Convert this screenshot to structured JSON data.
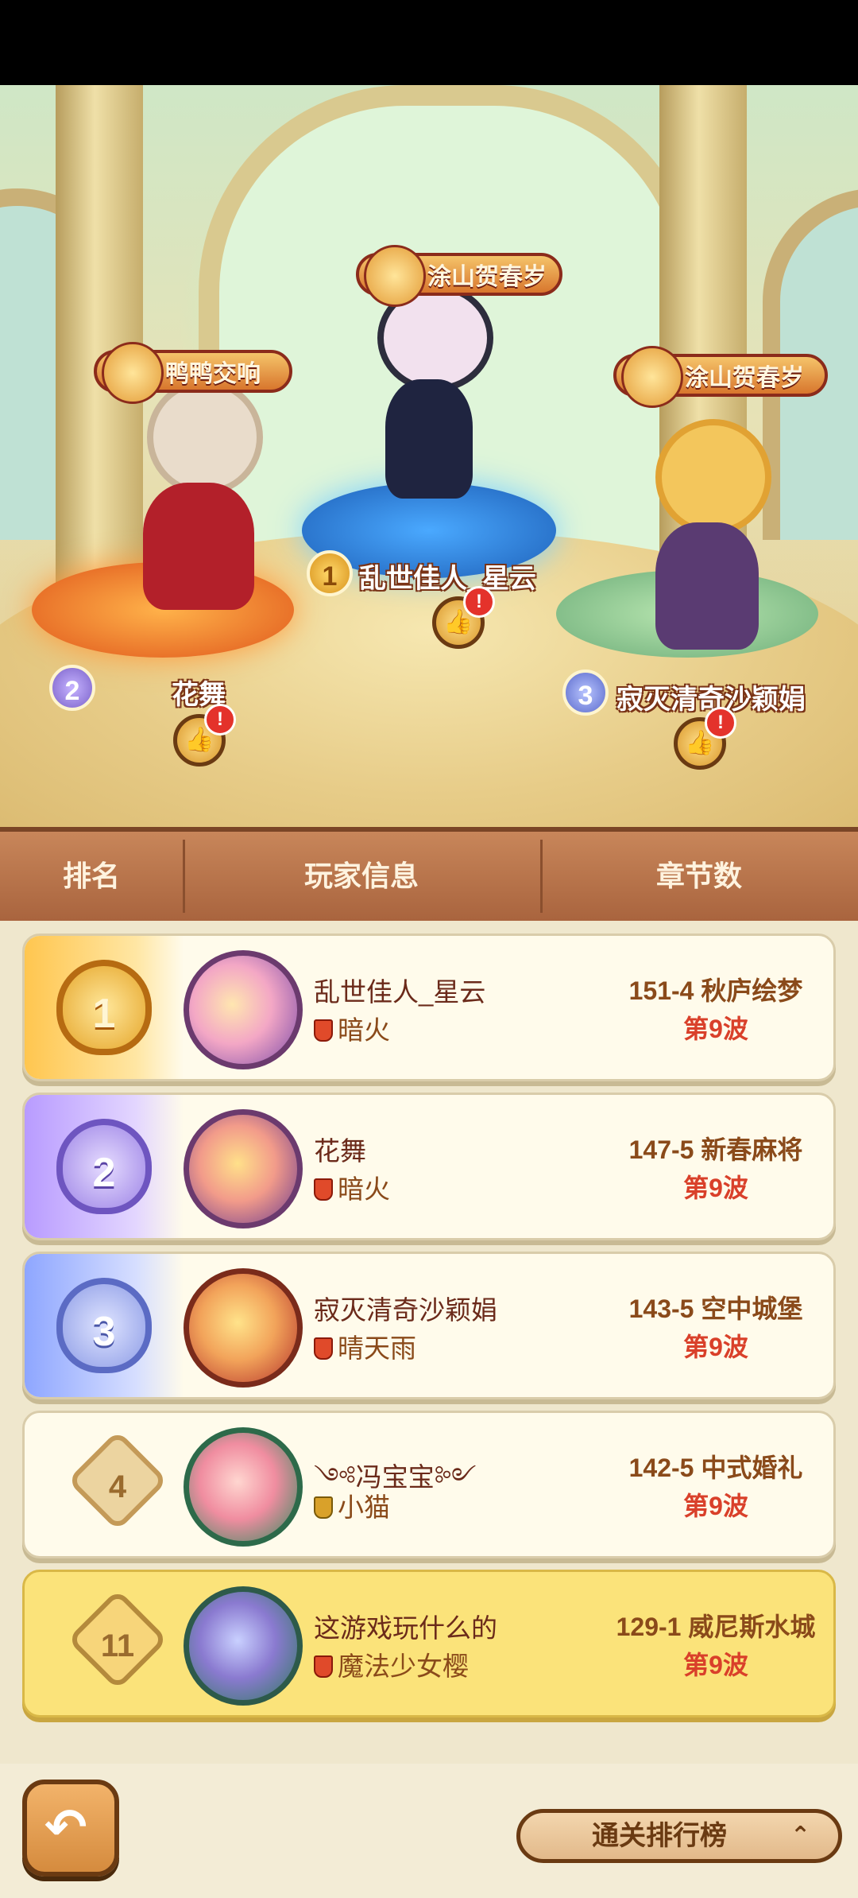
{
  "podium": {
    "first": {
      "rank": "1",
      "name": "乱世佳人_星云",
      "title": "涂山贺春岁"
    },
    "second": {
      "rank": "2",
      "name": "花舞",
      "title": "鸭鸭交响"
    },
    "third": {
      "rank": "3",
      "name": "寂灭清奇沙颖娟",
      "title": "涂山贺春岁"
    },
    "like_icon": "thumbs-up-icon",
    "alert_text": "!"
  },
  "table_header": {
    "rank": "排名",
    "player": "玩家信息",
    "chapter": "章节数"
  },
  "rows": [
    {
      "rank": "1",
      "name": "乱世佳人_星云",
      "guild": "暗火",
      "chapter": "151-4 秋庐绘梦",
      "wave": "第9波"
    },
    {
      "rank": "2",
      "name": "花舞",
      "guild": "暗火",
      "chapter": "147-5 新春麻将",
      "wave": "第9波"
    },
    {
      "rank": "3",
      "name": "寂灭清奇沙颖娟",
      "guild": "晴天雨",
      "chapter": "143-5 空中城堡",
      "wave": "第9波"
    },
    {
      "rank": "4",
      "name": "༺冯宝宝༻",
      "guild": "小猫",
      "chapter": "142-5 中式婚礼",
      "wave": "第9波"
    },
    {
      "rank": "11",
      "name": "这游戏玩什么的",
      "guild": "魔法少女樱",
      "chapter": "129-1 威尼斯水城",
      "wave": "第9波"
    }
  ],
  "footer": {
    "back_icon": "back-arrow-icon",
    "back_glyph": "↶",
    "leaderboard_label": "通关排行榜",
    "chevron_glyph": "⌃"
  },
  "colors": {
    "accent_gold": "#e5a52a",
    "highlight_row": "#fbe37a",
    "header_brown": "#a9643e",
    "wave_red": "#d9402a"
  }
}
